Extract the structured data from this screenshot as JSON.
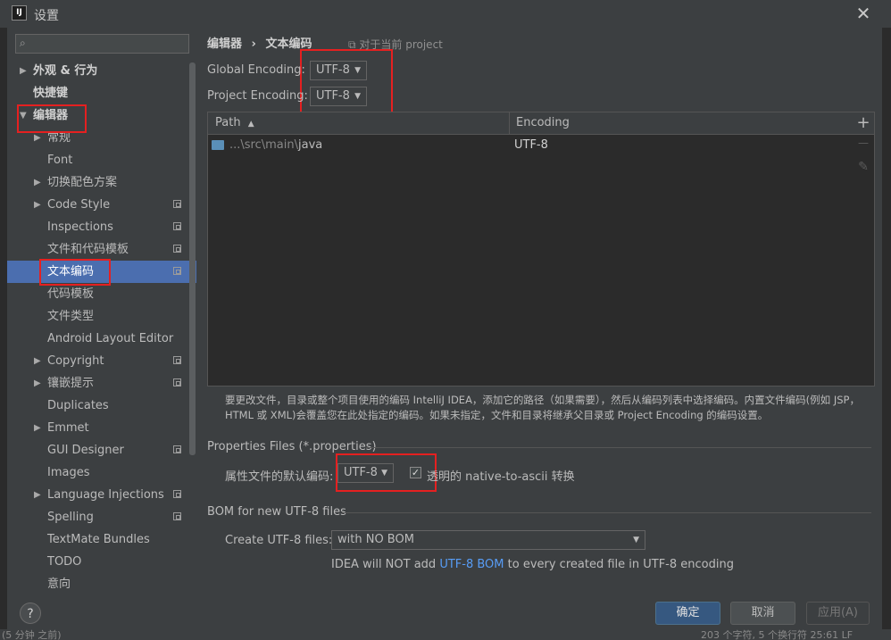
{
  "title": "设置",
  "search": {
    "placeholder": ""
  },
  "sidebar": {
    "items": [
      {
        "label": "外观 & 行为"
      },
      {
        "label": "快捷键"
      },
      {
        "label": "编辑器"
      },
      {
        "label": "常规"
      },
      {
        "label": "Font"
      },
      {
        "label": "切换配色方案"
      },
      {
        "label": "Code Style"
      },
      {
        "label": "Inspections"
      },
      {
        "label": "文件和代码模板"
      },
      {
        "label": "文本编码"
      },
      {
        "label": "代码模板"
      },
      {
        "label": "文件类型"
      },
      {
        "label": "Android Layout Editor"
      },
      {
        "label": "Copyright"
      },
      {
        "label": "镶嵌提示"
      },
      {
        "label": "Duplicates"
      },
      {
        "label": "Emmet"
      },
      {
        "label": "GUI Designer"
      },
      {
        "label": "Images"
      },
      {
        "label": "Language Injections"
      },
      {
        "label": "Spelling"
      },
      {
        "label": "TextMate Bundles"
      },
      {
        "label": "TODO"
      },
      {
        "label": "意向"
      }
    ]
  },
  "breadcrumb": {
    "parent": "编辑器",
    "separator": "›",
    "current": "文本编码"
  },
  "scope_note": "对于当前 project",
  "encoding": {
    "global_label": "Global Encoding:",
    "global_value": "UTF-8",
    "project_label": "Project Encoding:",
    "project_value": "UTF-8"
  },
  "table": {
    "col_path": "Path",
    "col_path_sort": "▲",
    "col_encoding": "Encoding",
    "rows": [
      {
        "path_prefix": "...\\src\\main\\",
        "path_last": "java",
        "encoding": "UTF-8"
      }
    ],
    "add_icon": "+",
    "remove_icon": "—",
    "edit_icon": "✎"
  },
  "help_text": "要更改文件，目录或整个项目使用的编码 IntelliJ IDEA，添加它的路径（如果需要），然后从编码列表中选择编码。内置文件编码(例如 JSP，HTML 或 XML)会覆盖您在此处指定的编码。如果未指定，文件和目录将继承父目录或 Project Encoding 的编码设置。",
  "properties": {
    "section_title": "Properties Files (*.properties)",
    "default_label": "属性文件的默认编码:",
    "default_value": "UTF-8",
    "checkbox_checked": true,
    "checkbox_label": "透明的 native-to-ascii 转换"
  },
  "bom": {
    "section_title": "BOM for new UTF-8 files",
    "create_label": "Create UTF-8 files:",
    "create_value": "with NO BOM",
    "note_prefix": "IDEA will NOT add ",
    "note_link": "UTF-8 BOM",
    "note_suffix": " to every created file in UTF-8 encoding"
  },
  "buttons": {
    "help": "?",
    "ok": "确定",
    "cancel": "取消",
    "apply": "应用(A)"
  },
  "statusbar": {
    "left": "(5 分钟 之前)",
    "right": "203 个字符, 5 个换行符    25:61  LF"
  },
  "colors": {
    "selection": "#4b6eaf",
    "highlight": "#e52020",
    "primary_button": "#365880",
    "link": "#589df6"
  }
}
